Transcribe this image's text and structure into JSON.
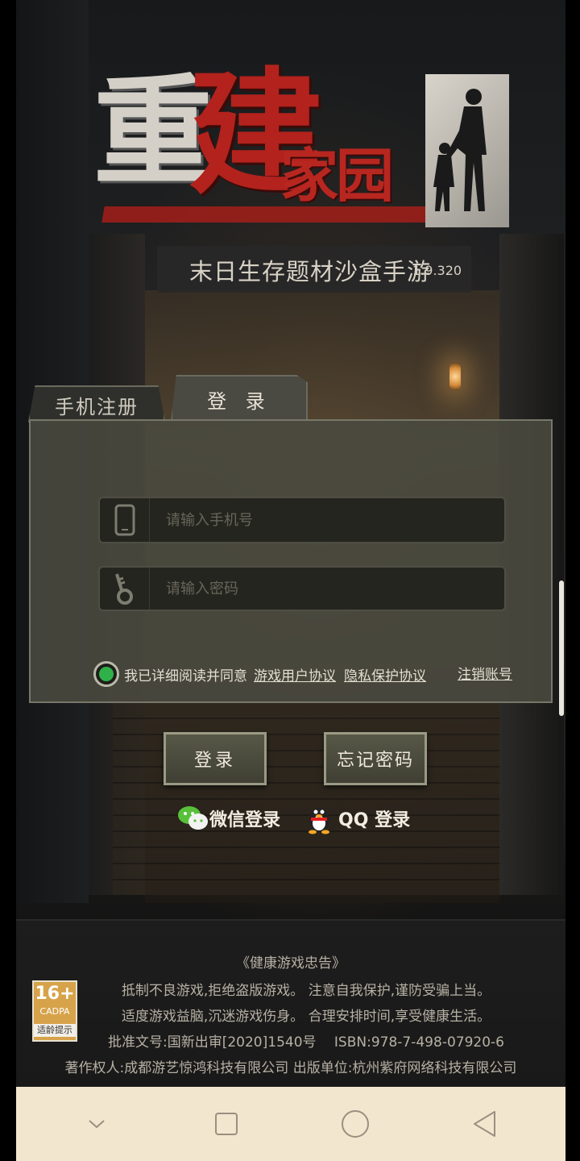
{
  "title": {
    "char1": "重",
    "char2": "建",
    "chars_small": "家园",
    "subtitle": "末日生存题材沙盒手游",
    "version": "1.9.320"
  },
  "tabs": {
    "register": "手机注册",
    "login": "登 录"
  },
  "form": {
    "phone_placeholder": "请输入手机号",
    "password_placeholder": "请输入密码",
    "agree_text": "我已详细阅读并同意",
    "user_agreement": "游戏用户协议",
    "privacy_agreement": "隐私保护协议",
    "cancel_account": "注销账号"
  },
  "buttons": {
    "login": "登录",
    "forgot": "忘记密码",
    "wechat": "微信登录",
    "qq": "QQ 登录"
  },
  "footer": {
    "health_title": "《健康游戏忠告》",
    "line1": "抵制不良游戏,拒绝盗版游戏。 注意自我保护,谨防受骗上当。",
    "line2": "适度游戏益脑,沉迷游戏伤身。 合理安排时间,享受健康生活。",
    "line3": "批准文号:国新出审[2020]1540号　 ISBN:978-7-498-07920-6",
    "copyright": "著作权人:成都游艺惊鸿科技有限公司 出版单位:杭州紫府网络科技有限公司",
    "age_rating": "16+",
    "age_org": "CADPA",
    "age_tip": "适龄提示"
  },
  "icons": {
    "phone": "phone-icon",
    "key": "key-icon",
    "wechat": "wechat-icon",
    "qq": "qq-penguin-icon",
    "nav_down": "chevron-down-icon",
    "nav_recent": "square-icon",
    "nav_home": "circle-icon",
    "nav_back": "triangle-back-icon"
  },
  "colors": {
    "title_red": "#b3221d",
    "check_green": "#2fb14a",
    "navbar_bg": "#f3e6cf"
  }
}
